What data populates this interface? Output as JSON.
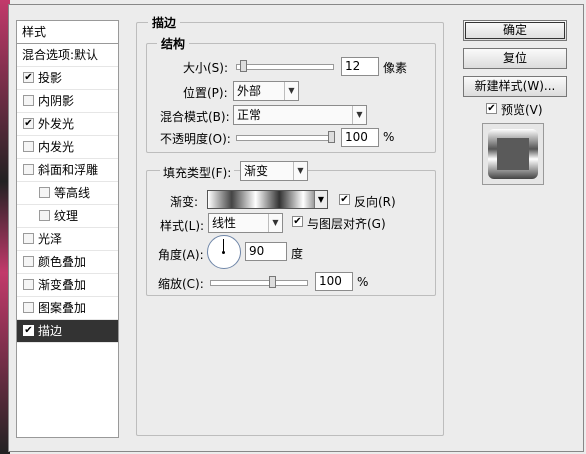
{
  "left_panel": {
    "header": "样式",
    "items": [
      {
        "label": "混合选项:默认"
      },
      {
        "label": "投影",
        "checked": true
      },
      {
        "label": "内阴影",
        "checked": false
      },
      {
        "label": "外发光",
        "checked": true
      },
      {
        "label": "内发光",
        "checked": false
      },
      {
        "label": "斜面和浮雕",
        "checked": false
      },
      {
        "label": "等高线",
        "checked": false
      },
      {
        "label": "纹理",
        "checked": false
      },
      {
        "label": "光泽",
        "checked": false
      },
      {
        "label": "颜色叠加",
        "checked": false
      },
      {
        "label": "渐变叠加",
        "checked": false
      },
      {
        "label": "图案叠加",
        "checked": false
      },
      {
        "label": "描边",
        "checked": true,
        "selected": true
      }
    ]
  },
  "stroke": {
    "title": "描边",
    "structure_title": "结构",
    "size_label": "大小(S):",
    "size_value": "12",
    "size_unit": "像素",
    "position_label": "位置(P):",
    "position_value": "外部",
    "blend_label": "混合模式(B):",
    "blend_value": "正常",
    "opacity_label": "不透明度(O):",
    "opacity_value": "100",
    "opacity_unit": "%",
    "fill_type_label": "填充类型(F):",
    "fill_type_value": "渐变",
    "gradient_label": "渐变:",
    "reverse_label": "反向(R)",
    "reverse_checked": true,
    "style_label": "样式(L):",
    "style_value": "线性",
    "align_label": "与图层对齐(G)",
    "align_checked": true,
    "angle_label": "角度(A):",
    "angle_value": "90",
    "angle_unit": "度",
    "scale_label": "缩放(C):",
    "scale_value": "100",
    "scale_unit": "%",
    "slider_levels": {
      "size": 0.06,
      "opacity": 1.0,
      "scale": 0.5
    }
  },
  "buttons": {
    "ok": "确定",
    "reset": "复位",
    "new_style": "新建样式(W)...",
    "preview": "预览(V)",
    "preview_checked": true
  },
  "colors": {
    "selected_bg": "#333333",
    "dialog_bg": "#ececec"
  }
}
